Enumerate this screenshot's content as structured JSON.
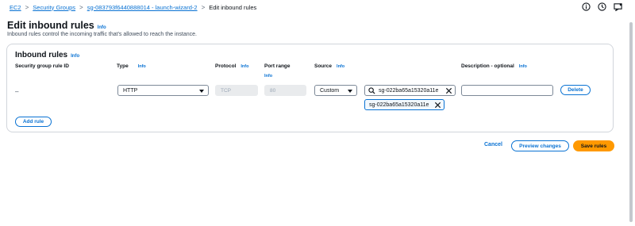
{
  "breadcrumb": {
    "items": [
      "EC2",
      "Security Groups",
      "sg-083793f6440888014 - launch-wizard-2",
      "Edit inbound rules"
    ]
  },
  "header": {
    "title": "Edit inbound rules",
    "info": "Info",
    "description": "Inbound rules control the incoming traffic that's allowed to reach the instance."
  },
  "panel": {
    "title": "Inbound rules",
    "info": "Info",
    "columns": {
      "rule_id": "Security group rule ID",
      "type": "Type",
      "protocol": "Protocol",
      "port_range": "Port range",
      "source": "Source",
      "description": "Description - optional",
      "info": "Info"
    },
    "rule": {
      "rule_id": "–",
      "type": "HTTP",
      "protocol": "TCP",
      "port_range": "80",
      "source": "Custom",
      "source_query": "sg-022ba65a15320a11e",
      "source_token": "sg-022ba65a15320a11e",
      "description": "",
      "delete_label": "Delete"
    },
    "add_rule_label": "Add rule"
  },
  "footer": {
    "cancel_label": "Cancel",
    "preview_label": "Preview changes",
    "save_label": "Save rules"
  },
  "icons": {
    "top": [
      "info-circle-icon",
      "history-icon",
      "notifications-icon"
    ],
    "search": "search-icon",
    "clear": "close-icon",
    "caret": "caret-down-icon"
  },
  "colors": {
    "link": "#0972d3",
    "primary": "#ff9900",
    "border": "#7d8998"
  }
}
